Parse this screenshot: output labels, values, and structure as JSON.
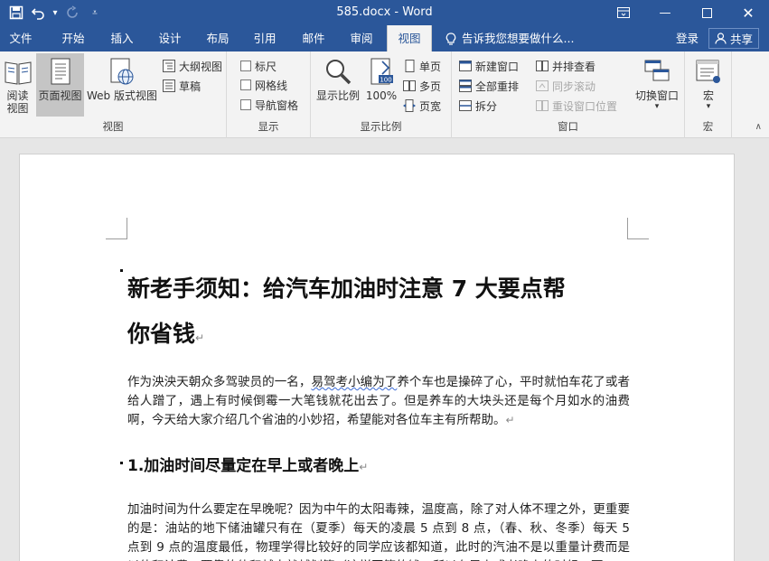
{
  "titlebar": {
    "title": "585.docx - Word",
    "qat_more": "≡"
  },
  "tabs": [
    {
      "label": "文件"
    },
    {
      "label": "开始"
    },
    {
      "label": "插入"
    },
    {
      "label": "设计"
    },
    {
      "label": "布局"
    },
    {
      "label": "引用"
    },
    {
      "label": "邮件"
    },
    {
      "label": "审阅"
    },
    {
      "label": "视图"
    }
  ],
  "tell_me": "告诉我您想要做什么...",
  "account": {
    "signin": "登录",
    "share": "共享"
  },
  "ribbon": {
    "views": {
      "label": "视图",
      "read_mode": "阅读\n视图",
      "print_layout": "页面视图",
      "web_layout": "Web 版式视图",
      "outline": "大纲视图",
      "draft": "草稿"
    },
    "show": {
      "label": "显示",
      "ruler": "标尺",
      "gridlines": "网格线",
      "nav_pane": "导航窗格"
    },
    "zoom": {
      "label": "显示比例",
      "zoom": "显示比例",
      "hundred": "100%",
      "one_page": "单页",
      "multi_page": "多页",
      "page_width": "页宽"
    },
    "window": {
      "label": "窗口",
      "new_window": "新建窗口",
      "arrange_all": "全部重排",
      "split": "拆分",
      "side_by_side": "并排查看",
      "sync_scroll": "同步滚动",
      "reset_position": "重设窗口位置",
      "switch_windows": "切换窗口"
    },
    "macros": {
      "label": "宏",
      "macros": "宏"
    }
  },
  "document": {
    "title_line1": "新老手须知：给汽车加油时注意 7 大要点帮",
    "title_line2": "你省钱",
    "para_mark": "↵",
    "intro_a": "作为泱泱天朝众多驾驶员的一名，",
    "intro_b": "易驾考小编为了",
    "intro_c": "养个车也是操碎了心，平时就怕车花了或者给人蹭了，遇上有时候倒霉一大笔钱就花出去了。但是养车的大块头还是每个月如水的油费啊，今天给大家介绍几个省油的小妙招，希望能对各位车主有所帮助。",
    "heading1": "1.加油时间尽量定在早上或者晚上",
    "para2": "加油时间为什么要定在早晚呢？因为中午的太阳毒辣，温度高，除了对人体不理之外，更重要的是：油站的地下储油罐只有在（夏季）每天的凌晨 5 点到 8 点，（春、秋、冬季）每天 5 点到 9 点的温度最低，物理学得比较好的同学应该都知道，此时的汽油不是以重量计费而是以体积计费，要靠的体积越大就越划算（这样同等的钱，所以在早上或者晚上的时候，更"
  }
}
